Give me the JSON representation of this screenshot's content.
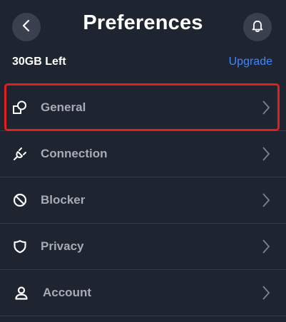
{
  "header": {
    "title": "Preferences",
    "back_icon": "chevron-left-icon",
    "notification_icon": "bell-icon"
  },
  "storage": {
    "remaining": "30GB Left",
    "upgrade_label": "Upgrade"
  },
  "menu": {
    "items": [
      {
        "label": "General",
        "icon": "shapes-icon"
      },
      {
        "label": "Connection",
        "icon": "plug-icon"
      },
      {
        "label": "Blocker",
        "icon": "block-icon"
      },
      {
        "label": "Privacy",
        "icon": "shield-icon"
      },
      {
        "label": "Account",
        "icon": "user-icon"
      }
    ],
    "highlighted_item": "General"
  },
  "colors": {
    "background": "#1f2431",
    "accent": "#3f86ff",
    "highlight": "#e0201b",
    "label": "#a6abb5"
  }
}
